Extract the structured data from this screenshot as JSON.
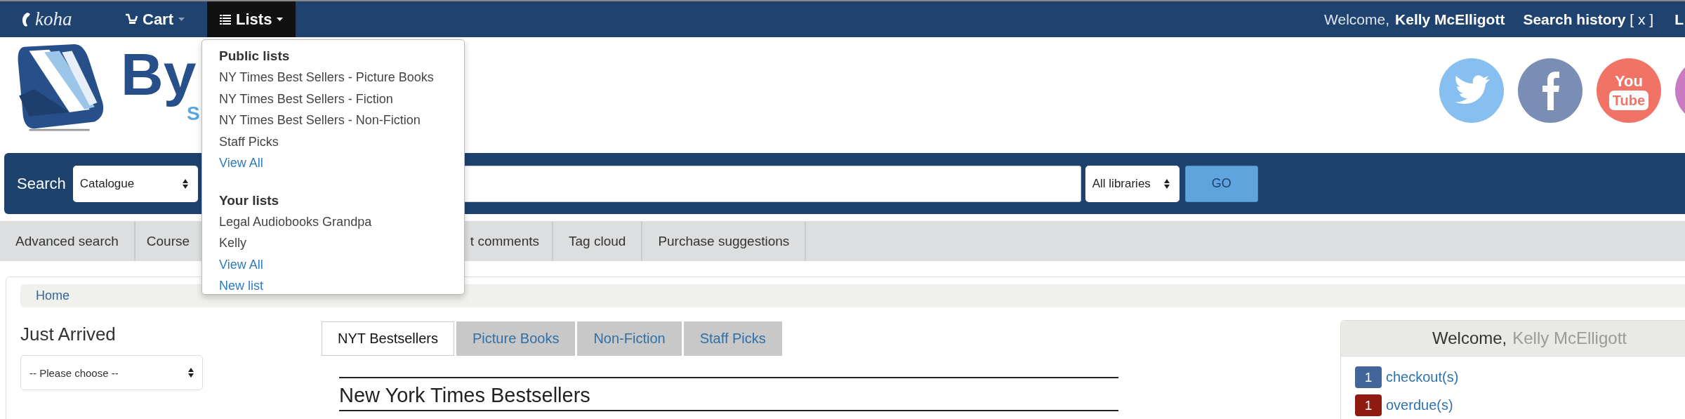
{
  "top_bar": {
    "logo": "koha",
    "menus": [
      {
        "label": "Cart",
        "expanded": false
      },
      {
        "label": "Lists",
        "expanded": true
      }
    ],
    "welcome": "Welcome,",
    "user": "Kelly McElligott",
    "search_history": "Search history",
    "clear": "[ x ]",
    "cut_link": "L"
  },
  "lists_menu": {
    "sections": [
      {
        "heading": "Public lists",
        "items": [
          {
            "kind": "list",
            "label": "NY Times Best Sellers - Picture Books"
          },
          {
            "kind": "list",
            "label": "NY Times Best Sellers - Fiction"
          },
          {
            "kind": "list",
            "label": "NY Times Best Sellers - Non-Fiction"
          },
          {
            "kind": "list",
            "label": "Staff Picks"
          },
          {
            "kind": "link",
            "label": "View All"
          }
        ]
      },
      {
        "heading": "Your lists",
        "items": [
          {
            "kind": "list",
            "label": "Legal Audiobooks Grandpa"
          },
          {
            "kind": "list",
            "label": "Kelly"
          },
          {
            "kind": "link",
            "label": "View All"
          },
          {
            "kind": "link",
            "label": "New list"
          }
        ]
      }
    ]
  },
  "header": {
    "logo_text": "By",
    "logo_subtext": "S",
    "social": [
      {
        "kind": "twitter",
        "color": "#86bff0"
      },
      {
        "kind": "facebook",
        "color": "#7a8db5"
      },
      {
        "kind": "youtube",
        "color": "#f07365",
        "label_lines": [
          "You",
          "Tube"
        ]
      },
      {
        "kind": "instagram",
        "color": "#c97bc1"
      }
    ]
  },
  "search": {
    "label": "Search",
    "scope": "Catalogue",
    "library": "All libraries",
    "button": "GO"
  },
  "nav": [
    "Advanced search",
    "Course",
    "t comments",
    "Tag cloud",
    "Purchase suggestions"
  ],
  "breadcrumb": "Home",
  "just_arrived": {
    "title": "Just Arrived",
    "select": "-- Please choose --"
  },
  "tabs": [
    {
      "label": "NYT Bestsellers",
      "selected": true
    },
    {
      "label": "Picture Books",
      "selected": false
    },
    {
      "label": "Non-Fiction",
      "selected": false
    },
    {
      "label": "Staff Picks",
      "selected": false
    }
  ],
  "list_title": "New York Times Bestsellers",
  "user_panel": {
    "greeting": "Welcome,",
    "name": "Kelly McElligott",
    "stats": [
      {
        "count": "1",
        "label": "checkout(s)",
        "color": "#42669a"
      },
      {
        "count": "1",
        "label": "overdue(s)",
        "color": "#8e1a10"
      }
    ]
  }
}
